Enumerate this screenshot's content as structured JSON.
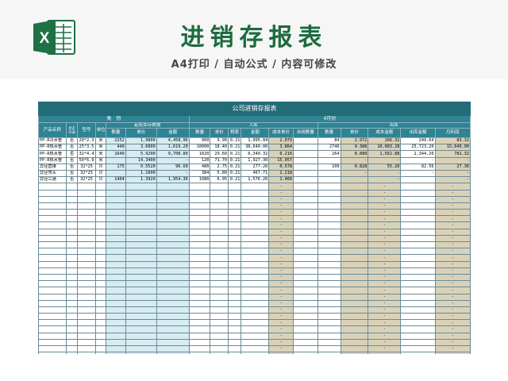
{
  "header": {
    "title": "进销存报表",
    "subtitle": "A4打印 / 自动公式 / 内容可修改"
  },
  "sheet": {
    "title": "公司进销存报表",
    "category_label": "类　别",
    "month_label": "4月份",
    "col_product": "产品名称",
    "col_is_cost": "是否外调",
    "col_model": "型号",
    "col_unit": "单位",
    "group_opening": "起初库存数据",
    "group_in": "入库",
    "group_out": "出库",
    "col_open_qty": "数量",
    "col_open_price": "单价",
    "col_open_amount": "金额",
    "col_in_qty": "数量",
    "col_in_price": "单价",
    "col_in_tax": "税率",
    "col_in_amount": "金额",
    "col_cost_price": "成本单价",
    "col_self_use": "自用数量",
    "col_out_qty": "数量",
    "col_out_price": "单价",
    "col_out_cost": "成本金额",
    "col_out_amount": "出库金额",
    "col_profit": "月利润",
    "rows": [
      [
        "PP-R冷水管",
        "否",
        "20*2.3",
        "米",
        "2252",
        "1.9800",
        "4,458.96",
        "960",
        "9.90",
        "0.21",
        "1,995.84",
        "2.079",
        "",
        "84",
        "2.972",
        "166.32",
        "249.64",
        "83.32"
      ],
      [
        "PP-R热水管",
        "否",
        "25*3.5",
        "米",
        "440",
        "3.6800",
        "1,619.20",
        "10000",
        "18.40",
        "0.21",
        "38,640.00",
        "3.864",
        "",
        "2740",
        "9.388",
        "10,083.28",
        "25,723.20",
        "15,640.00"
      ],
      [
        "PP-R热水管",
        "否",
        "32*4.4",
        "米",
        "1640",
        "5.9200",
        "9,708.80",
        "1020",
        "29.60",
        "0.21",
        "6,340.32",
        "6.216",
        "",
        "264",
        "8.880",
        "1,562.88",
        "2,344.20",
        "781.32"
      ],
      [
        "PP-R热水管",
        "否",
        "50*6.9",
        "米",
        "",
        "14.3400",
        "-",
        "120",
        "71.70",
        "0.21",
        "1,927.30",
        "15.057",
        "",
        "",
        "-",
        "-",
        "-",
        "-"
      ],
      [
        "异径直接",
        "否",
        "32*25",
        "只",
        "175",
        "0.5520",
        "96.60",
        "480",
        "2.75",
        "0.21",
        "277.20",
        "0.578",
        "",
        "100",
        "0.828",
        "55.20",
        "82.56",
        "27.36"
      ],
      [
        "异径弯头",
        "否",
        "32*25",
        "只",
        "",
        "1.1600",
        "-",
        "384",
        "5.80",
        "0.21",
        "467.71",
        "1.218",
        "",
        "",
        "-",
        "-",
        "-",
        "-"
      ],
      [
        "异径三通",
        "否",
        "32*25",
        "只",
        "1404",
        "1.3920",
        "1,954.36",
        "1080",
        "6.95",
        "0.21",
        "1,576.26",
        "1.460",
        "",
        "",
        "",
        "-",
        "",
        "-"
      ]
    ],
    "blank_cost_value": "-",
    "blank_out_cost_value": "-",
    "blank_profit_value": "-",
    "blank_row_count": 28
  },
  "colors": {
    "title_green": "#1d6b3f",
    "header_teal": "#2e8395",
    "title_teal": "#246b78",
    "light_blue": "#d6ecf1",
    "tan": "#d9d2b9",
    "excel_green": "#1e7145"
  }
}
